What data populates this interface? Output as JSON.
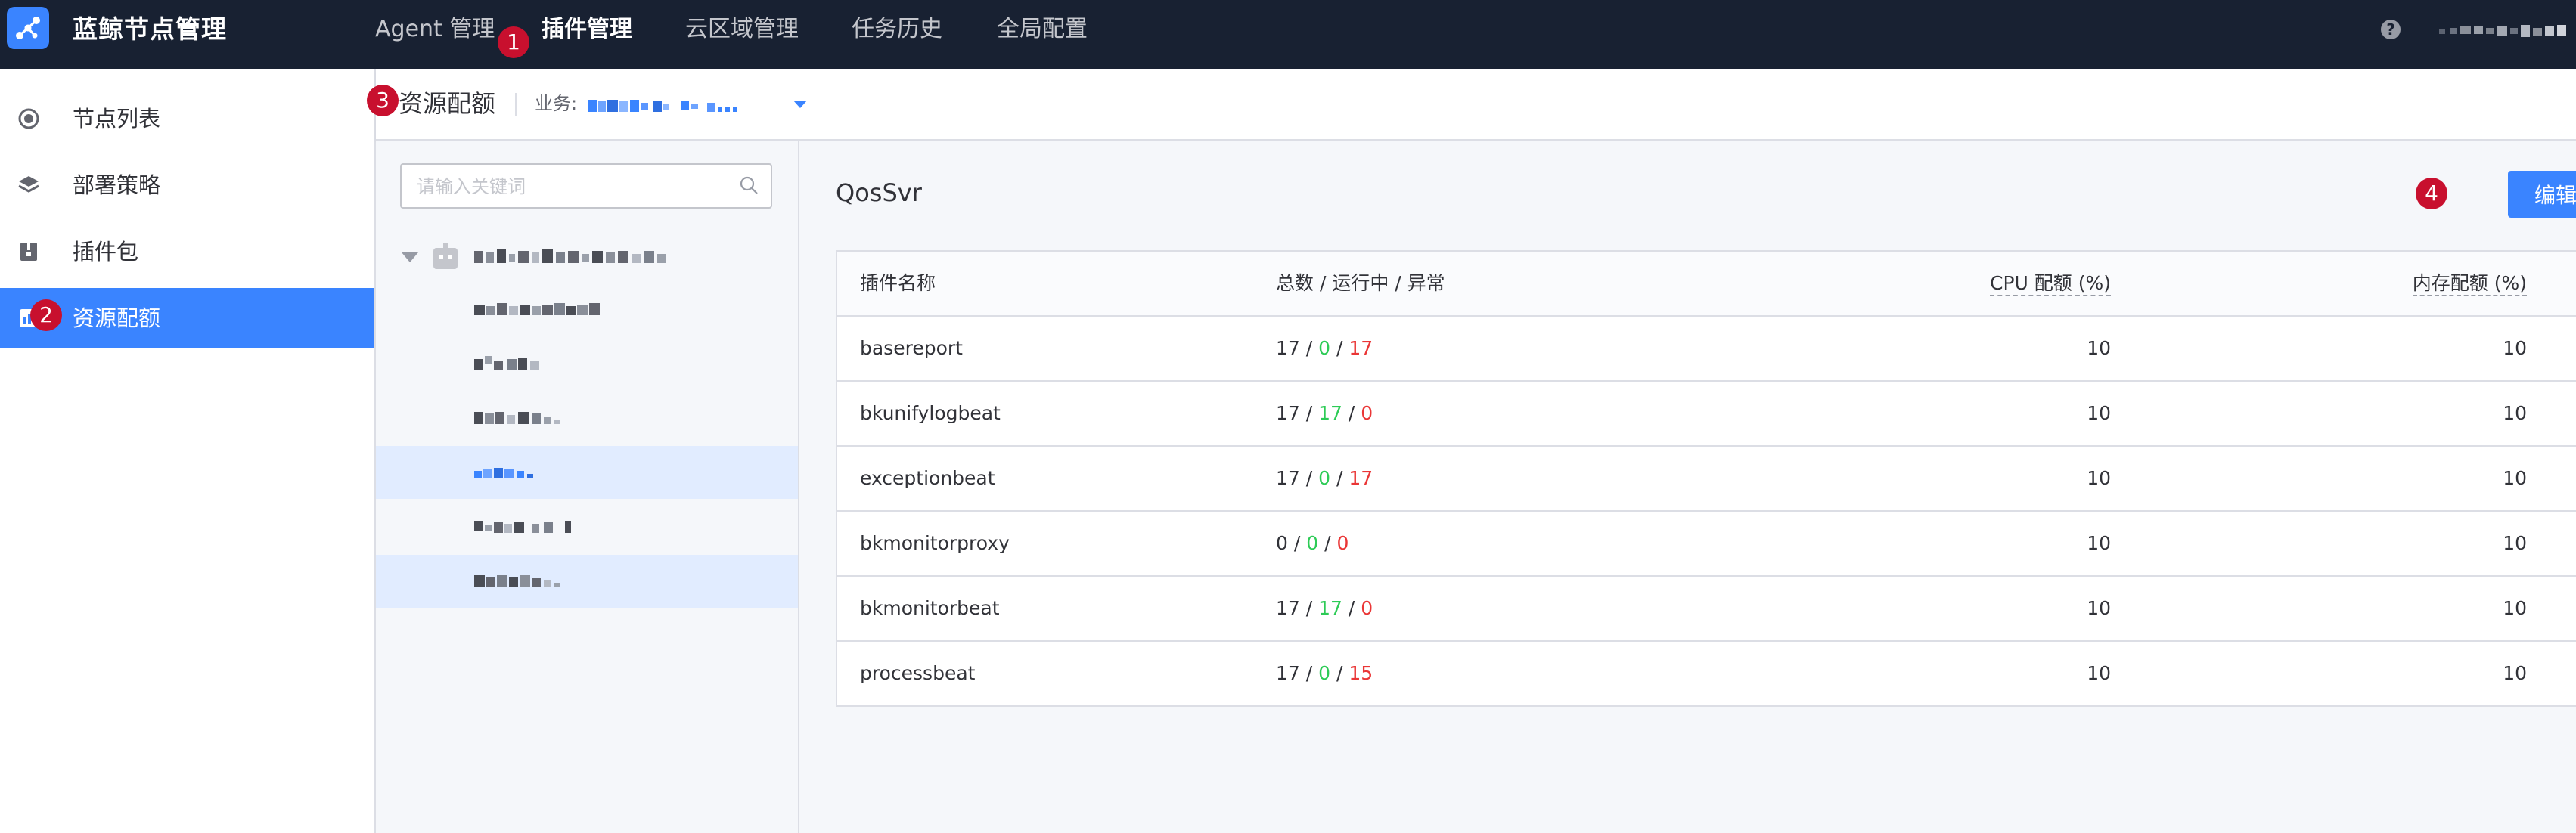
{
  "app": {
    "title": "蓝鲸节点管理",
    "logo_icon": "node-manager-logo-icon",
    "accent_color": "#3a84ff",
    "topbar_color": "#182132"
  },
  "topnav": {
    "items": [
      {
        "label": "Agent 管理",
        "active": false
      },
      {
        "label": "插件管理",
        "active": true
      },
      {
        "label": "云区域管理",
        "active": false
      },
      {
        "label": "任务历史",
        "active": false
      },
      {
        "label": "全局配置",
        "active": false
      }
    ],
    "help_icon": "?"
  },
  "sidebar": {
    "items": [
      {
        "label": "节点列表",
        "icon": "node-list-icon",
        "active": false
      },
      {
        "label": "部署策略",
        "icon": "layers-icon",
        "active": false
      },
      {
        "label": "插件包",
        "icon": "package-icon",
        "active": false
      },
      {
        "label": "资源配额",
        "icon": "quota-icon",
        "active": true
      }
    ]
  },
  "header": {
    "title": "资源配额",
    "business_label": "业务:"
  },
  "tree": {
    "search_placeholder": "请输入关键词"
  },
  "main": {
    "group_title": "QosSvr",
    "edit_label": "编辑",
    "table": {
      "columns": [
        "插件名称",
        "总数 / 运行中 / 异常",
        "CPU 配额 (%)",
        "内存配额 (%)"
      ],
      "rows": [
        {
          "name": "basereport",
          "total": "17",
          "running": "0",
          "abnormal": "17",
          "cpu": "10",
          "mem": "10"
        },
        {
          "name": "bkunifylogbeat",
          "total": "17",
          "running": "17",
          "abnormal": "0",
          "cpu": "10",
          "mem": "10"
        },
        {
          "name": "exceptionbeat",
          "total": "17",
          "running": "0",
          "abnormal": "17",
          "cpu": "10",
          "mem": "10"
        },
        {
          "name": "bkmonitorproxy",
          "total": "0",
          "running": "0",
          "abnormal": "0",
          "cpu": "10",
          "mem": "10"
        },
        {
          "name": "bkmonitorbeat",
          "total": "17",
          "running": "17",
          "abnormal": "0",
          "cpu": "10",
          "mem": "10"
        },
        {
          "name": "processbeat",
          "total": "17",
          "running": "0",
          "abnormal": "15",
          "cpu": "10",
          "mem": "10"
        }
      ],
      "running_color": "#2dcb56",
      "abnormal_color": "#ea3636"
    }
  },
  "annotations": [
    "1",
    "2",
    "3",
    "4"
  ]
}
